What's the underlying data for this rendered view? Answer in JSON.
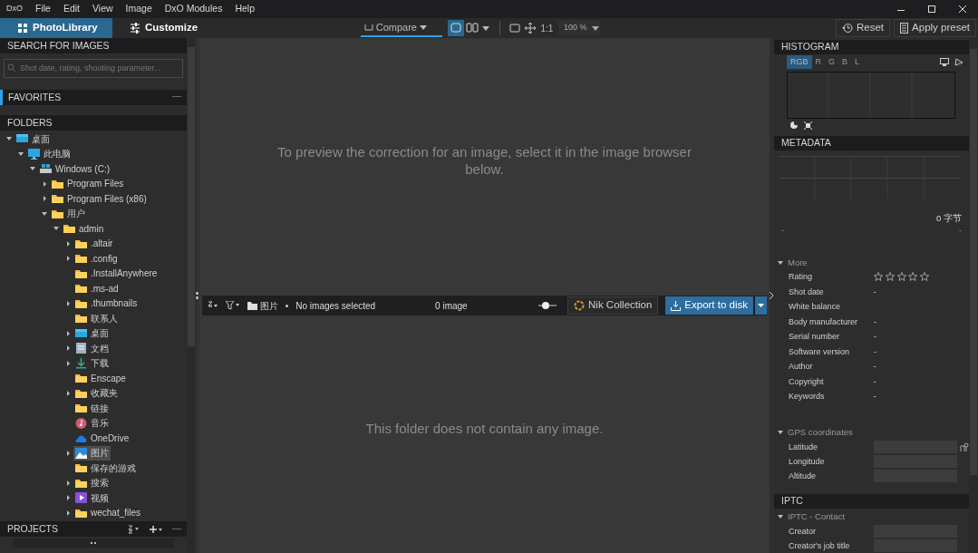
{
  "menu": {
    "logo": "DxO",
    "items": [
      "File",
      "Edit",
      "View",
      "Image",
      "DxO Modules",
      "Help"
    ]
  },
  "tabs": [
    {
      "label": "PhotoLibrary",
      "selected": true
    },
    {
      "label": "Customize",
      "selected": false
    }
  ],
  "toolbar": {
    "compare": "Compare",
    "view_modes": [
      {
        "kind": "single",
        "selected": true
      },
      {
        "kind": "split",
        "selected": false
      }
    ],
    "zoom_ratio": "1:1",
    "zoom": "100 %",
    "reset": "Reset",
    "apply_preset": "Apply preset"
  },
  "left_panel": {
    "search": {
      "title": "SEARCH FOR IMAGES",
      "placeholder": "Shot date, rating, shooting parameter..."
    },
    "favorites": {
      "title": "FAVORITES"
    },
    "folders": {
      "title": "FOLDERS",
      "tree": [
        {
          "label": "桌面",
          "kind": "desktop",
          "expanded": true,
          "selected": false,
          "children": [
            {
              "label": "此电脑",
              "kind": "pc",
              "expanded": true,
              "selected": false,
              "children": [
                {
                  "label": "Windows (C:)",
                  "kind": "drive",
                  "expanded": true,
                  "selected": false,
                  "children": [
                    {
                      "label": "Program Files",
                      "kind": "folder",
                      "expanded": false,
                      "selected": false
                    },
                    {
                      "label": "Program Files (x86)",
                      "kind": "folder",
                      "expanded": false,
                      "selected": false
                    },
                    {
                      "label": "用户",
                      "kind": "folder",
                      "expanded": true,
                      "selected": false,
                      "children": [
                        {
                          "label": "admin",
                          "kind": "folder",
                          "expanded": true,
                          "selected": false,
                          "children": [
                            {
                              "label": ".altair",
                              "kind": "folder",
                              "expanded": false,
                              "selected": false
                            },
                            {
                              "label": ".config",
                              "kind": "folder",
                              "expanded": false,
                              "selected": false
                            },
                            {
                              "label": ".InstallAnywhere",
                              "kind": "folder",
                              "selected": false
                            },
                            {
                              "label": ".ms-ad",
                              "kind": "folder",
                              "selected": false
                            },
                            {
                              "label": ".thumbnails",
                              "kind": "folder",
                              "expanded": false,
                              "selected": false
                            },
                            {
                              "label": "联系人",
                              "kind": "folder",
                              "selected": false
                            },
                            {
                              "label": "桌面",
                              "kind": "desktop",
                              "expanded": false,
                              "selected": false
                            },
                            {
                              "label": "文档",
                              "kind": "documents",
                              "expanded": false,
                              "selected": false
                            },
                            {
                              "label": "下载",
                              "kind": "download",
                              "expanded": false,
                              "selected": false
                            },
                            {
                              "label": "Enscape",
                              "kind": "folder",
                              "selected": false
                            },
                            {
                              "label": "收藏夹",
                              "kind": "folder",
                              "expanded": false,
                              "selected": false
                            },
                            {
                              "label": "链接",
                              "kind": "folder",
                              "selected": false
                            },
                            {
                              "label": "音乐",
                              "kind": "music",
                              "selected": false
                            },
                            {
                              "label": "OneDrive",
                              "kind": "cloud",
                              "selected": false
                            },
                            {
                              "label": "图片",
                              "kind": "pictures",
                              "expanded": false,
                              "selected": true
                            },
                            {
                              "label": "保存的游戏",
                              "kind": "folder",
                              "selected": false
                            },
                            {
                              "label": "搜索",
                              "kind": "folder",
                              "expanded": false,
                              "selected": false
                            },
                            {
                              "label": "视频",
                              "kind": "video",
                              "expanded": false,
                              "selected": false
                            },
                            {
                              "label": "wechat_files",
                              "kind": "folder",
                              "expanded": false,
                              "selected": false
                            }
                          ]
                        }
                      ]
                    }
                  ]
                }
              ]
            }
          ]
        }
      ]
    },
    "projects": {
      "title": "PROJECTS"
    }
  },
  "viewer": {
    "message": "To preview the correction for an image, select it in the image browser below."
  },
  "filmstrip": {
    "folder": "图片",
    "separator": "•",
    "status": "No images selected",
    "count": "0 image",
    "level": 0.4,
    "nik": "Nik Collection",
    "export": "Export to disk",
    "message": "This folder does not contain any image."
  },
  "histogram": {
    "title": "HISTOGRAM",
    "channels": [
      {
        "label": "RGB",
        "selected": true
      },
      {
        "label": "R",
        "selected": false
      },
      {
        "label": "G",
        "selected": false
      },
      {
        "label": "B",
        "selected": false
      },
      {
        "label": "L",
        "selected": false
      }
    ]
  },
  "metadata": {
    "title": "METADATA",
    "size": "0 字节",
    "range_min": "-",
    "range_max": "-",
    "sections": [
      {
        "title": "More",
        "expanded": true,
        "rows": [
          {
            "label": "Rating",
            "kind": "stars",
            "stars": 0
          },
          {
            "label": "Shot date",
            "kind": "text",
            "value": "-"
          },
          {
            "label": "White balance",
            "kind": "text"
          },
          {
            "label": "Body manufacturer",
            "kind": "text",
            "value": "-"
          },
          {
            "label": "Serial number",
            "kind": "text",
            "value": "-"
          },
          {
            "label": "Software version",
            "kind": "text",
            "value": "-"
          },
          {
            "label": "Author",
            "kind": "text",
            "value": "-"
          },
          {
            "label": "Copyright",
            "kind": "text",
            "value": "-"
          },
          {
            "label": "Keywords",
            "kind": "text",
            "value": "-"
          }
        ]
      },
      {
        "title": "GPS coordinates",
        "expanded": true,
        "rows": [
          {
            "label": "Latitude",
            "kind": "field",
            "pin": true
          },
          {
            "label": "Longitude",
            "kind": "field"
          },
          {
            "label": "Altitude",
            "kind": "field"
          }
        ]
      }
    ]
  },
  "iptc": {
    "title": "IPTC",
    "sections": [
      {
        "title": "IPTC - Contact",
        "expanded": true,
        "rows": [
          {
            "label": "Creator",
            "kind": "field"
          },
          {
            "label": "Creator's job title",
            "kind": "field"
          }
        ]
      }
    ]
  }
}
